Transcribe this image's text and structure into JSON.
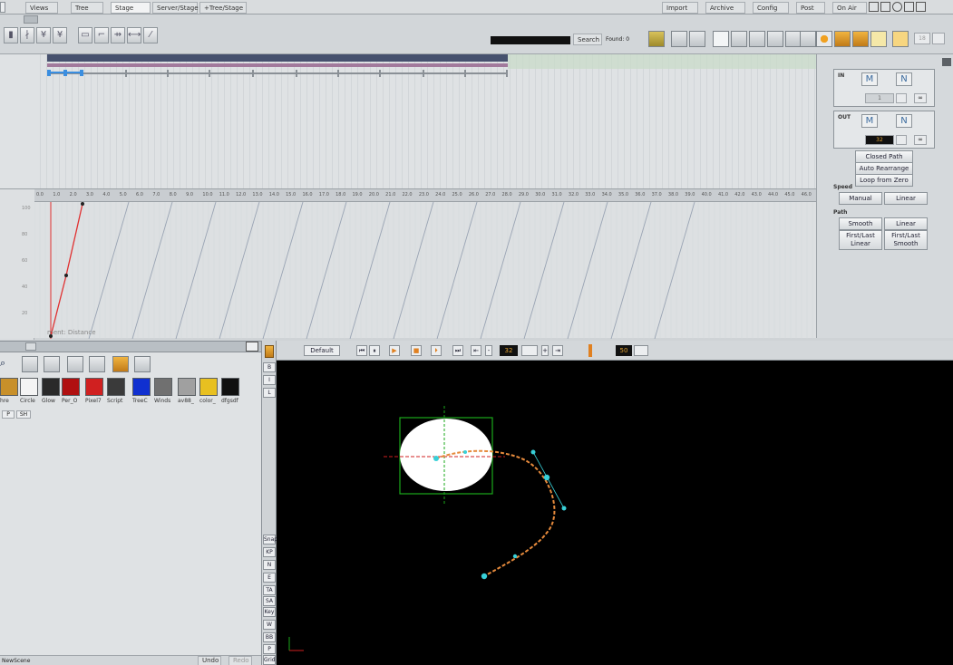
{
  "menubar": {
    "tabs": [
      "Views",
      "Tree",
      "Stage",
      "Server/Stage",
      "+Tree/Stage"
    ],
    "right_tabs": [
      "Import",
      "Archive",
      "Config",
      "Post",
      "On Air"
    ]
  },
  "toolbar": {
    "search_label": "Search",
    "found_label": "Found: 0",
    "field_value": "18"
  },
  "ruler": {
    "ticks": [
      "0.0",
      "1.0",
      "2.0",
      "3.0",
      "4.0",
      "5.0",
      "6.0",
      "7.0",
      "8.0",
      "9.0",
      "10.0",
      "11.0",
      "12.0",
      "13.0",
      "14.0",
      "15.0",
      "16.0",
      "17.0",
      "18.0",
      "19.0",
      "20.0",
      "21.0",
      "22.0",
      "23.0",
      "24.0",
      "25.0",
      "26.0",
      "27.0",
      "28.0",
      "29.0",
      "30.0",
      "31.0",
      "32.0",
      "33.0",
      "34.0",
      "35.0",
      "36.0",
      "37.0",
      "38.0",
      "39.0",
      "40.0",
      "41.0",
      "42.0",
      "43.0",
      "44.0",
      "45.0",
      "46.0"
    ],
    "y_ticks": [
      "100",
      "80",
      "60",
      "40",
      "20"
    ],
    "channel_label": "ment: Distance"
  },
  "right_panel": {
    "in_label": "IN",
    "in_value": "1",
    "out_label": "OUT",
    "out_value": "32",
    "inf": "∞",
    "closed_path": "Closed Path",
    "auto_rearrange": "Auto Rearrange",
    "loop_from_zero": "Loop from Zero",
    "speed_label": "Speed",
    "manual": "Manual",
    "linear": "Linear",
    "path_label": "Path",
    "smooth": "Smooth",
    "path_linear": "Linear",
    "first_last_linear": "First/Last Linear",
    "first_last_smooth": "First/Last Smooth"
  },
  "left_panel": {
    "thumbs": [
      "hre",
      "Circle",
      "Glow",
      "Per_O",
      "Pixel7",
      "Script",
      "TreeC",
      "Winds",
      "av88_",
      "color_",
      "dfgsdf"
    ],
    "tabs": [
      "P",
      "SH"
    ],
    "status_text": "NewScene",
    "undo": "Undo",
    "redo": "Redo"
  },
  "side_bar": {
    "top": [
      "B",
      "I",
      "L"
    ],
    "bottom": [
      "Snap",
      "KP",
      "N",
      "E",
      "TA",
      "SA",
      "Key",
      "W",
      "BB",
      "P",
      "Grid"
    ]
  },
  "viewport_toolbar": {
    "default_label": "Default",
    "frame_value": "32",
    "end_value": "50"
  },
  "colors": {
    "path_orange": "#e68a3c",
    "keyframe_cyan": "#38d0d8",
    "bbox_green": "#1aa81a",
    "curve_red": "#e03030",
    "highlight_blue": "#3a8ee0"
  }
}
